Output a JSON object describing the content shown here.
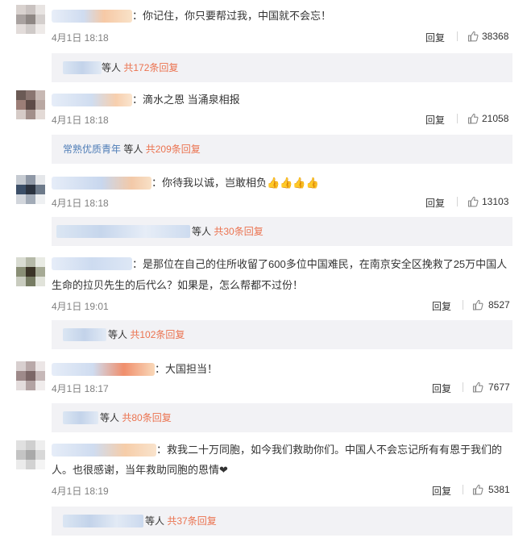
{
  "comments": [
    {
      "text": "：你记住，你只要帮过我，中国就不会忘！",
      "time": "4月1日 18:18",
      "reply_label": "回复",
      "likes": "38368",
      "sub_user_suffix": "等人",
      "sub_reply_link": "共172条回复"
    },
    {
      "text": "：滴水之恩 当涌泉相报",
      "time": "4月1日 18:18",
      "reply_label": "回复",
      "likes": "21058",
      "sub_user": "常熟优质青年",
      "sub_user_suffix": "等人",
      "sub_reply_link": "共209条回复"
    },
    {
      "text": "：你待我以诚，岂敢相负",
      "emoji": "👍👍👍👍",
      "time": "4月1日 18:18",
      "reply_label": "回复",
      "likes": "13103",
      "sub_user_suffix": "等人",
      "sub_reply_link": "共30条回复"
    },
    {
      "text_line1": "：是那位在自己的住所收留了600多位中国难民，在南京安全区挽救了25万中国人",
      "text_line2": "生命的拉贝先生的后代么？如果是，怎么帮都不过份！",
      "time": "4月1日 19:01",
      "reply_label": "回复",
      "likes": "8527",
      "sub_user_suffix": "等人",
      "sub_reply_link": "共102条回复"
    },
    {
      "text": "：大国担当！",
      "time": "4月1日 18:17",
      "reply_label": "回复",
      "likes": "7677",
      "sub_user_suffix": "等人",
      "sub_reply_link": "共80条回复"
    },
    {
      "text_line1": "：救我二十万同胞，如今我们救助你们。中国人不会忘记所有有恩于我们的",
      "text_line2": "人。也很感谢，当年救助同胞的恩情❤",
      "time": "4月1日 18:19",
      "reply_label": "回复",
      "likes": "5381",
      "sub_user_suffix": "等人",
      "sub_reply_link": "共37条回复"
    }
  ],
  "icons": {
    "like": "thumbs-up-icon"
  },
  "colors": {
    "link": "#eb7350",
    "user_link": "#4d7cb6",
    "sub_bg": "#f2f2f5"
  }
}
